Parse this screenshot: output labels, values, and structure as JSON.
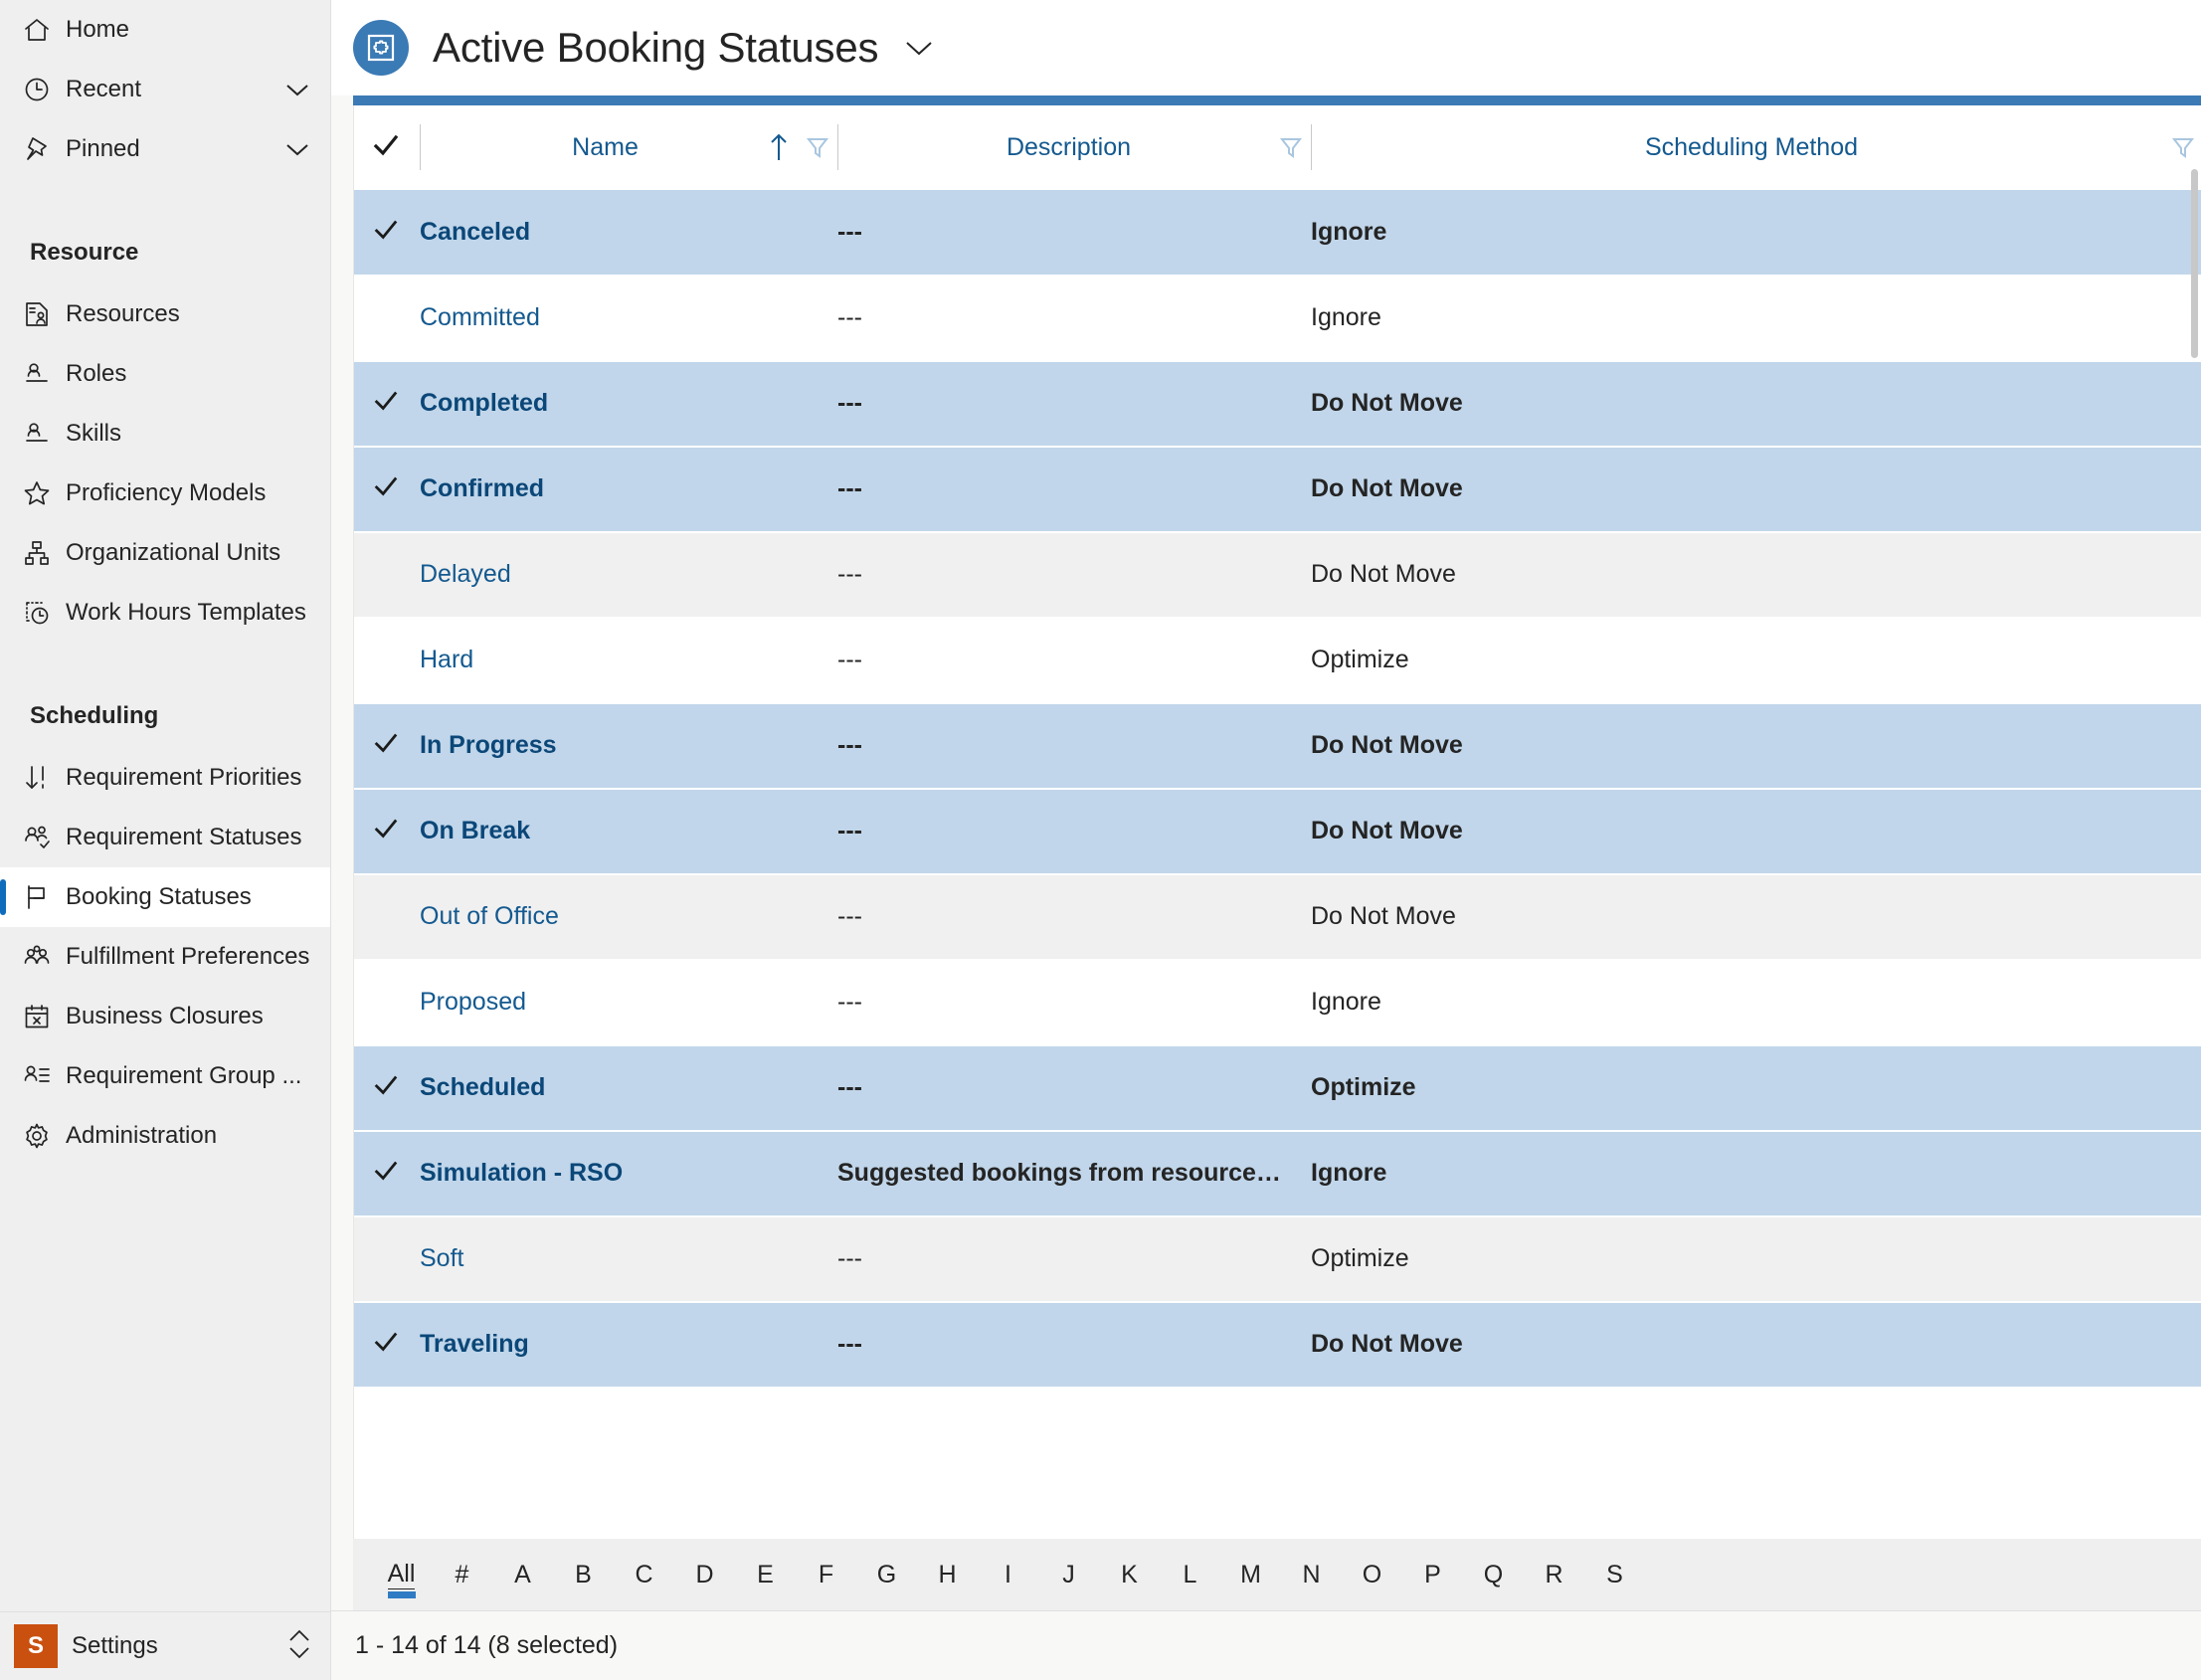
{
  "sidebar": {
    "top_items": [
      {
        "label": "Home",
        "icon": "home-icon",
        "chevron": false
      },
      {
        "label": "Recent",
        "icon": "clock-icon",
        "chevron": true
      },
      {
        "label": "Pinned",
        "icon": "pin-icon",
        "chevron": true
      }
    ],
    "groups": [
      {
        "title": "Resource",
        "items": [
          {
            "label": "Resources",
            "icon": "resource-card-icon"
          },
          {
            "label": "Roles",
            "icon": "person-line-icon"
          },
          {
            "label": "Skills",
            "icon": "person-line-icon"
          },
          {
            "label": "Proficiency Models",
            "icon": "star-icon"
          },
          {
            "label": "Organizational Units",
            "icon": "org-chart-icon"
          },
          {
            "label": "Work Hours Templates",
            "icon": "clock-dotted-icon"
          }
        ]
      },
      {
        "title": "Scheduling",
        "items": [
          {
            "label": "Requirement Priorities",
            "icon": "sort-down-icon"
          },
          {
            "label": "Requirement Statuses",
            "icon": "people-check-icon"
          },
          {
            "label": "Booking Statuses",
            "icon": "flag-icon",
            "selected": true
          },
          {
            "label": "Fulfillment Preferences",
            "icon": "people-group-icon"
          },
          {
            "label": "Business Closures",
            "icon": "calendar-x-icon"
          },
          {
            "label": "Requirement Group ...",
            "icon": "person-list-icon"
          },
          {
            "label": "Administration",
            "icon": "gear-icon"
          }
        ]
      }
    ],
    "settings": {
      "badge": "S",
      "label": "Settings",
      "chevron_icon": "chevron-up-down-icon"
    }
  },
  "header": {
    "title": "Active Booking Statuses",
    "icon": "booking-status-entity-icon",
    "dropdown_icon": "chevron-down-icon",
    "accent_color": "#3b7ab5"
  },
  "grid": {
    "select_all_icon": "checkmark-icon",
    "columns": [
      {
        "label": "Name",
        "sort": "ascending",
        "sort_icon": "arrow-up-icon",
        "filter_icon": "filter-funnel-icon"
      },
      {
        "label": "Description",
        "filter_icon": "filter-funnel-icon"
      },
      {
        "label": "Scheduling Method",
        "filter_icon": "filter-funnel-icon"
      }
    ],
    "rows": [
      {
        "selected": true,
        "name": "Canceled",
        "description": "---",
        "method": "Ignore"
      },
      {
        "selected": false,
        "name": "Committed",
        "description": "---",
        "method": "Ignore"
      },
      {
        "selected": true,
        "name": "Completed",
        "description": "---",
        "method": "Do Not Move"
      },
      {
        "selected": true,
        "name": "Confirmed",
        "description": "---",
        "method": "Do Not Move"
      },
      {
        "selected": false,
        "name": "Delayed",
        "description": "---",
        "method": "Do Not Move"
      },
      {
        "selected": false,
        "name": "Hard",
        "description": "---",
        "method": "Optimize"
      },
      {
        "selected": true,
        "name": "In Progress",
        "description": "---",
        "method": "Do Not Move"
      },
      {
        "selected": true,
        "name": "On Break",
        "description": "---",
        "method": "Do Not Move"
      },
      {
        "selected": false,
        "name": "Out of Office",
        "description": "---",
        "method": "Do Not Move"
      },
      {
        "selected": false,
        "name": "Proposed",
        "description": "---",
        "method": "Ignore"
      },
      {
        "selected": true,
        "name": "Scheduled",
        "description": "---",
        "method": "Optimize"
      },
      {
        "selected": true,
        "name": "Simulation - RSO",
        "description": "Suggested bookings from resource scheduling optimiz…",
        "method": "Ignore"
      },
      {
        "selected": false,
        "name": "Soft",
        "description": "---",
        "method": "Optimize"
      },
      {
        "selected": true,
        "name": "Traveling",
        "description": "---",
        "method": "Do Not Move"
      }
    ]
  },
  "alpha_bar": {
    "items": [
      "All",
      "#",
      "A",
      "B",
      "C",
      "D",
      "E",
      "F",
      "G",
      "H",
      "I",
      "J",
      "K",
      "L",
      "M",
      "N",
      "O",
      "P",
      "Q",
      "R",
      "S"
    ],
    "active": "All"
  },
  "footer": {
    "record_count": "1 - 14 of 14 (8 selected)"
  }
}
